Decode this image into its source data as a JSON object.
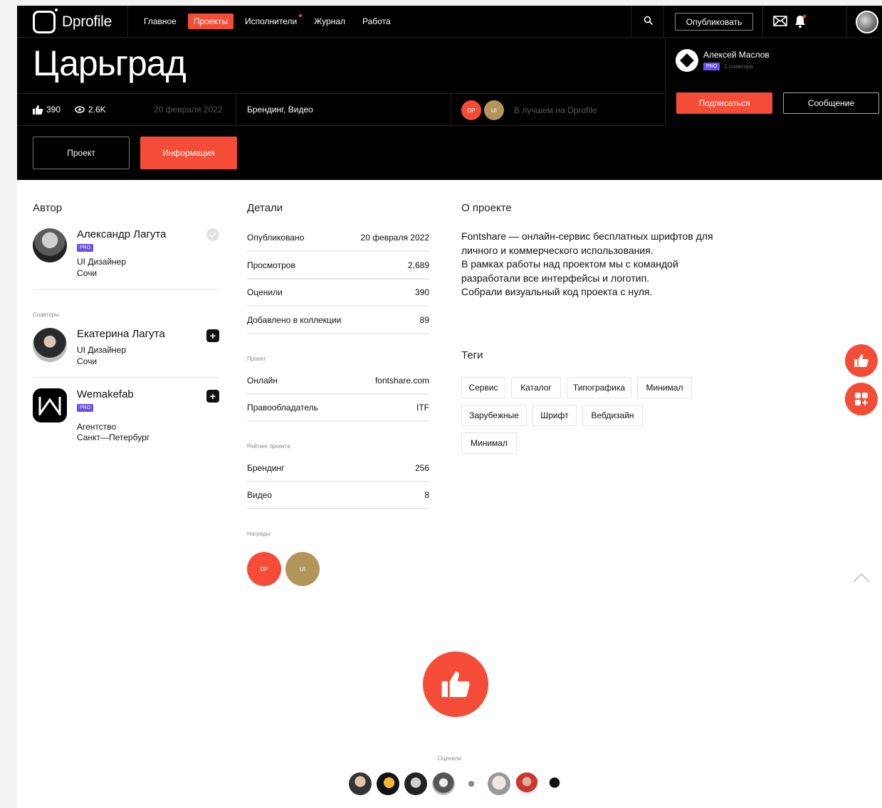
{
  "nav": {
    "logo": "Dprofile",
    "links": [
      "Главное",
      "Проекты",
      "Исполнители",
      "Журнал",
      "Работа"
    ],
    "active_link": "Проекты",
    "publish": "Опубликовать"
  },
  "project": {
    "title": "Царьград",
    "likes": "390",
    "views": "2.6K",
    "date": "20 февраля 2022",
    "categories": "Брендинг, Видео",
    "best_label": "В лучшем на Dprofile",
    "badges": [
      "DP",
      "UI"
    ]
  },
  "owner": {
    "name": "Алексей Маслов",
    "pro": "PRO",
    "coauthors": "2 соавтора",
    "subscribe": "Подписаться",
    "message": "Сообщение"
  },
  "tabs": [
    "Проект",
    "Информация"
  ],
  "author_section": {
    "heading": "Автор",
    "author": {
      "name": "Александр Лагута",
      "pro": "PRO",
      "role": "UI Дизайнер",
      "city": "Сочи"
    },
    "coauthors_label": "Соавторы",
    "coauthors": [
      {
        "name": "Екатерина Лагута",
        "role": "UI Дизайнер",
        "city": "Сочи"
      },
      {
        "name": "Wemakefab",
        "pro": "PRO",
        "role": "Агентство",
        "city": "Санкт—Петербург"
      }
    ]
  },
  "details": {
    "heading": "Детали",
    "rows": [
      {
        "k": "Опубликовано",
        "v": "20 февраля 2022"
      },
      {
        "k": "Просмотров",
        "v": "2,689"
      },
      {
        "k": "Оценили",
        "v": "390"
      },
      {
        "k": "Добавлено в коллекции",
        "v": "89"
      }
    ],
    "project_label": "Проект",
    "project_rows": [
      {
        "k": "Онлайн",
        "v": "fontshare.com"
      },
      {
        "k": "Правообладатель",
        "v": "ITF"
      }
    ],
    "rating_label": "Рейтинг проекта",
    "rating_rows": [
      {
        "k": "Брендинг",
        "v": "256"
      },
      {
        "k": "Видео",
        "v": "8"
      }
    ],
    "awards_label": "Награды",
    "awards": [
      "DP",
      "UI"
    ]
  },
  "about": {
    "heading": "О проекте",
    "lines": [
      "Fontshare — онлайн-сервис бесплатных шрифтов для",
      "личного и коммерческого использования.",
      "В рамках работы над проектом мы с командой",
      "разработали все интерфейсы и логотип.",
      "Собрали визуальный код проекта с нуля."
    ],
    "tags_heading": "Теги",
    "tags": [
      "Сервис",
      "Каталог",
      "Типографика",
      "Минимал",
      "Зарубежные",
      "Шрифт",
      "Вебдизайн",
      "Минимал"
    ]
  },
  "footer": {
    "rated_label": "Оценили"
  },
  "colors": {
    "accent": "#f44c36",
    "pro": "#6c4ff0",
    "gold": "#b39559"
  }
}
